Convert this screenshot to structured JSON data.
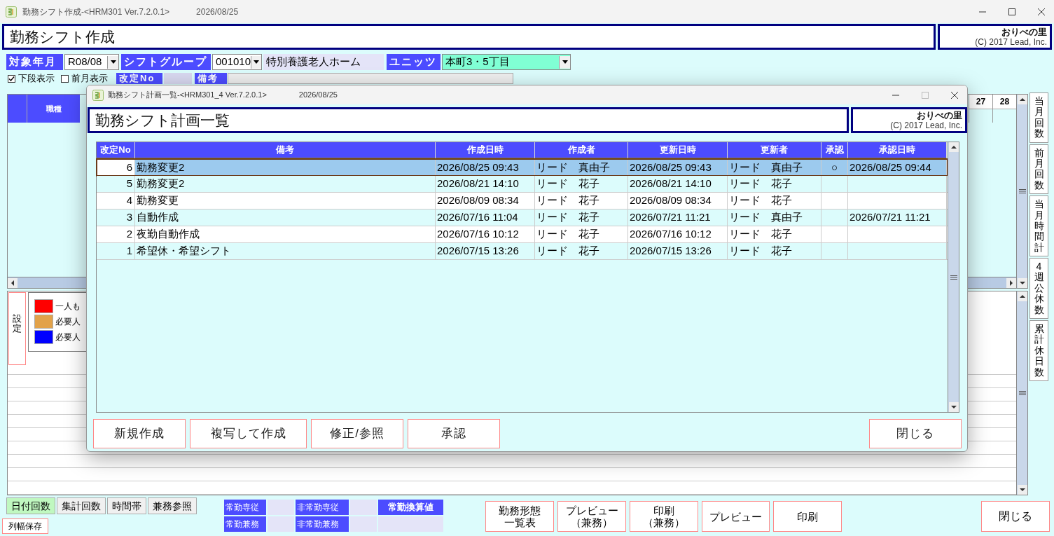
{
  "window": {
    "title": "勤務シフト作成-<HRM301 Ver.7.2.0.1>",
    "date": "2026/08/25"
  },
  "header": {
    "title": "勤務シフト作成",
    "brand": "おりべの里",
    "copyright": "(C) 2017 Lead, Inc."
  },
  "filters": {
    "month_label": "対象年月",
    "month": "R08/08",
    "group_label": "シフトグループ",
    "group_code": "001010",
    "group_name": "特別養護老人ホーム",
    "unit_label": "ユニッツ",
    "unit": "本町3・5丁目"
  },
  "options": [
    {
      "label": "下段表示",
      "checked": true
    },
    {
      "label": "前月表示",
      "checked": false
    }
  ],
  "revision": {
    "label": "改定No",
    "remarks_label": "備考"
  },
  "grid": {
    "job_header": "職種",
    "day_headers": [
      "27",
      "28"
    ]
  },
  "legend": {
    "button": "設定",
    "items": [
      {
        "label": "一人も",
        "color": "#ff0000"
      },
      {
        "label": "必要人",
        "color": "#e2a24a"
      },
      {
        "label": "必要人",
        "color": "#0000ff"
      }
    ]
  },
  "side_buttons": [
    "当月回数",
    "前月回数",
    "当月時間計",
    "4週公休数",
    "累計休日数"
  ],
  "view_tabs": [
    {
      "label": "日付回数",
      "selected": true
    },
    {
      "label": "集計回数",
      "selected": false
    },
    {
      "label": "時間帯",
      "selected": false
    },
    {
      "label": "兼務参照",
      "selected": false
    }
  ],
  "save_button": "列幅保存",
  "counts": [
    "常勤専従",
    "常勤兼務",
    "非常勤専従",
    "非常勤兼務"
  ],
  "fte_label": "常勤換算値",
  "actions": [
    {
      "lines": [
        "勤務形態",
        "一覧表"
      ]
    },
    {
      "lines": [
        "プレビュー",
        "（兼務）"
      ]
    },
    {
      "lines": [
        "印刷",
        "（兼務）"
      ]
    },
    {
      "lines": [
        "プレビュー"
      ]
    },
    {
      "lines": [
        "印刷"
      ]
    }
  ],
  "close_button": "閉じる",
  "dialog": {
    "title": "勤務シフト計画一覧-<HRM301_4 Ver.7.2.0.1>",
    "date": "2026/08/25",
    "header": "勤務シフト計画一覧",
    "brand": "おりべの里",
    "copyright": "(C) 2017 Lead, Inc.",
    "columns": [
      "改定No",
      "備考",
      "作成日時",
      "作成者",
      "更新日時",
      "更新者",
      "承認",
      "承認日時"
    ],
    "rows": [
      {
        "cells": [
          "6",
          "勤務変更2",
          "2026/08/25 09:43",
          "リード　真由子",
          "2026/08/25 09:43",
          "リード　真由子",
          "○",
          "2026/08/25 09:44"
        ],
        "selected": true
      },
      {
        "cells": [
          "5",
          "勤務変更2",
          "2026/08/21 14:10",
          "リード　花子",
          "2026/08/21 14:10",
          "リード　花子",
          "",
          ""
        ],
        "selected": false
      },
      {
        "cells": [
          "4",
          "勤務変更",
          "2026/08/09 08:34",
          "リード　花子",
          "2026/08/09 08:34",
          "リード　花子",
          "",
          ""
        ],
        "selected": false
      },
      {
        "cells": [
          "3",
          "自動作成",
          "2026/07/16 11:04",
          "リード　花子",
          "2026/07/21 11:21",
          "リード　真由子",
          "",
          "2026/07/21 11:21"
        ],
        "selected": false
      },
      {
        "cells": [
          "2",
          "夜勤自動作成",
          "2026/07/16 10:12",
          "リード　花子",
          "2026/07/16 10:12",
          "リード　花子",
          "",
          ""
        ],
        "selected": false
      },
      {
        "cells": [
          "1",
          "希望休・希望シフト",
          "2026/07/15 13:26",
          "リード　花子",
          "2026/07/15 13:26",
          "リード　花子",
          "",
          ""
        ],
        "selected": false
      }
    ],
    "buttons": [
      "新規作成",
      "複写して作成",
      "修正/参照",
      "承認"
    ],
    "close_button": "閉じる"
  }
}
